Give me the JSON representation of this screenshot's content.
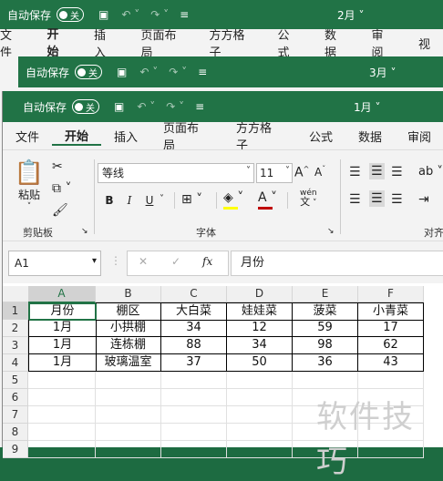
{
  "window_back": {
    "autosave_label": "自动保存",
    "toggle_state": "关",
    "doc_name": "2月",
    "tabs": [
      "文件",
      "开始",
      "插入",
      "页面布局",
      "方方格子",
      "公式",
      "数据",
      "审阅",
      "视"
    ]
  },
  "window_mid": {
    "autosave_label": "自动保存",
    "toggle_state": "关",
    "doc_name": "3月"
  },
  "window_front": {
    "autosave_label": "自动保存",
    "toggle_state": "关",
    "doc_name": "1月",
    "tabs": [
      "文件",
      "开始",
      "插入",
      "页面布局",
      "方方格子",
      "公式",
      "数据",
      "审阅"
    ],
    "clipboard": {
      "paste_label": "粘贴",
      "group_label": "剪贴板"
    },
    "font": {
      "name": "等线",
      "size": "11",
      "bold": "B",
      "italic": "I",
      "underline": "U",
      "wen": "wén",
      "wen_char": "文",
      "group_label": "字体",
      "grow": "A",
      "shrink": "A"
    },
    "align_group_label": "对齐",
    "namebox": "A1",
    "fx": "fx",
    "formula": "月份",
    "columns": [
      "A",
      "B",
      "C",
      "D",
      "E",
      "F"
    ],
    "rows": [
      [
        "1",
        "月份",
        "棚区",
        "大白菜",
        "娃娃菜",
        "菠菜",
        "小青菜"
      ],
      [
        "2",
        "1月",
        "小拱棚",
        "34",
        "12",
        "59",
        "17"
      ],
      [
        "3",
        "1月",
        "连栋棚",
        "88",
        "34",
        "98",
        "62"
      ],
      [
        "4",
        "1月",
        "玻璃温室",
        "37",
        "50",
        "36",
        "43"
      ],
      [
        "5",
        "",
        "",
        "",
        "",
        "",
        ""
      ],
      [
        "6",
        "",
        "",
        "",
        "",
        "",
        ""
      ],
      [
        "7",
        "",
        "",
        "",
        "",
        "",
        ""
      ],
      [
        "8",
        "",
        "",
        "",
        "",
        "",
        ""
      ],
      [
        "9",
        "",
        "",
        "",
        "",
        "",
        ""
      ]
    ]
  },
  "watermark": "软件技巧",
  "colors": {
    "green": "#217346",
    "accent_fill": "#ffff00",
    "accent_font": "#c00000"
  }
}
